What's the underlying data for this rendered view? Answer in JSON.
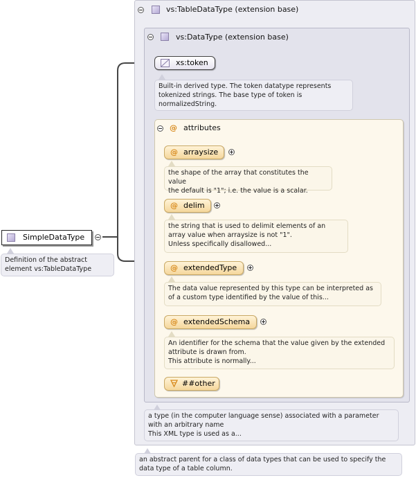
{
  "root": {
    "name": "SimpleDataType",
    "doc": "Definition of the abstract\nelement vs:TableDataType"
  },
  "table_data_type": {
    "title": "vs:TableDataType (extension base)",
    "doc": "an abstract parent for a class of data types that can be used to specify the\ndata type of a table column."
  },
  "data_type": {
    "title": "vs:DataType (extension base)",
    "doc": "a type (in the computer language sense) associated with a parameter\nwith an arbitrary name\nThis XML type is used as a..."
  },
  "token": {
    "label": "xs:token",
    "doc": "Built-in derived type. The token datatype represents\ntokenized strings. The base type of token is\nnormalizedString."
  },
  "attributes": {
    "title": "attributes",
    "items": [
      {
        "name": "arraysize",
        "doc": "the shape of the array that constitutes the value\nthe default is \"1\"; i.e. the value is a scalar."
      },
      {
        "name": "delim",
        "doc": "the string that is used to delimit elements of an\narray value when arraysize is not \"1\".\nUnless specifically disallowed..."
      },
      {
        "name": "extendedType",
        "doc": "The data value represented by this type can be interpreted as\nof a custom type identified by the value of this..."
      },
      {
        "name": "extendedSchema",
        "doc": "An identifier for the schema that the value given by the extended\nattribute is drawn from.\nThis attribute is normally..."
      }
    ],
    "any_other": "##other"
  },
  "colors": {
    "outer_bg": "#ededf3",
    "attribute_bg": "#fdf8ec",
    "attribute_pill": "#f5d79c",
    "connector": "#444444"
  },
  "icons": {
    "collapse": "circle-minus-icon",
    "expand": "circle-plus-icon",
    "complex_type": "type-square-icon",
    "simple_type": "simple-type-icon",
    "attribute": "at-sign-icon",
    "any_attribute": "any-attribute-icon"
  }
}
